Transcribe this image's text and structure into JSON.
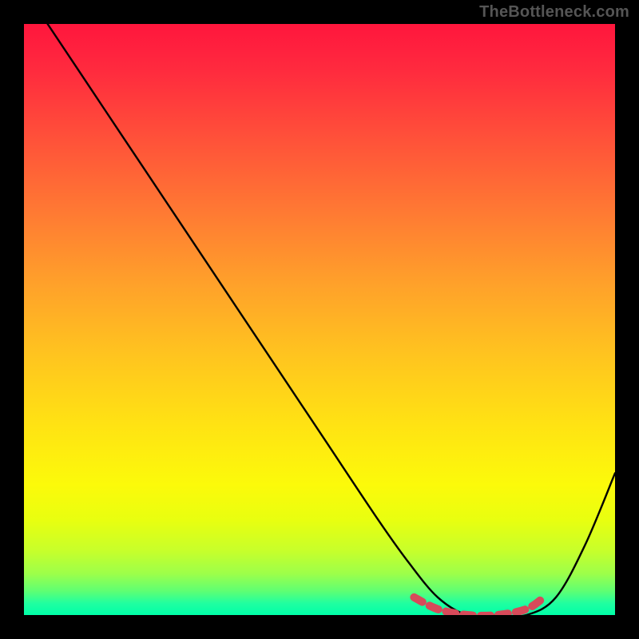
{
  "watermark": "TheBottleneck.com",
  "colors": {
    "page_bg": "#000000",
    "curve_stroke": "#000000",
    "highlight_stroke": "#d74a5a",
    "watermark_text": "#555555"
  },
  "chart_data": {
    "type": "line",
    "title": "",
    "xlabel": "",
    "ylabel": "",
    "xlim": [
      0,
      100
    ],
    "ylim": [
      0,
      100
    ],
    "grid": false,
    "legend": false,
    "series": [
      {
        "name": "bottleneck-curve",
        "x": [
          4,
          10,
          20,
          30,
          40,
          50,
          60,
          65,
          70,
          75,
          80,
          85,
          90,
          95,
          100
        ],
        "y": [
          100,
          91,
          76,
          61,
          46,
          31,
          16,
          9,
          3,
          0,
          0,
          0,
          3,
          12,
          24
        ]
      }
    ],
    "highlight_region": {
      "x": [
        66,
        70,
        75,
        80,
        85,
        88
      ],
      "y": [
        3,
        1,
        0,
        0,
        1,
        3
      ]
    },
    "background_gradient": {
      "direction": "vertical",
      "stops": [
        {
          "pos": 0.0,
          "color": "#ff163d"
        },
        {
          "pos": 0.2,
          "color": "#ff5339"
        },
        {
          "pos": 0.44,
          "color": "#ffa12a"
        },
        {
          "pos": 0.68,
          "color": "#ffe313"
        },
        {
          "pos": 0.84,
          "color": "#e8ff10"
        },
        {
          "pos": 0.96,
          "color": "#5dff74"
        },
        {
          "pos": 1.0,
          "color": "#00ffa8"
        }
      ]
    }
  }
}
